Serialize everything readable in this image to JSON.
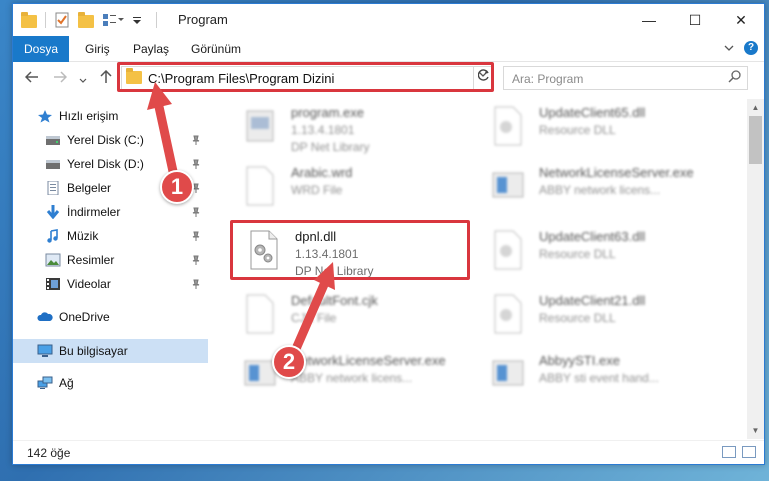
{
  "window": {
    "title": "Program",
    "controls": {
      "minimize": "—",
      "maximize": "☐",
      "close": "✕"
    }
  },
  "ribbon": {
    "tabs": [
      {
        "label": "Dosya"
      },
      {
        "label": "Giriş"
      },
      {
        "label": "Paylaş"
      },
      {
        "label": "Görünüm"
      }
    ],
    "expand_icon": "chevron-down-icon",
    "help_label": "?"
  },
  "address_bar": {
    "path": "C:\\Program Files\\Program Dizini",
    "search_placeholder": "Ara: Program"
  },
  "sidebar": {
    "items": [
      {
        "label": "Hızlı erişim",
        "icon": "star-icon",
        "pinned": false
      },
      {
        "label": "Yerel Disk (C:)",
        "icon": "drive-icon",
        "pinned": true
      },
      {
        "label": "Yerel Disk (D:)",
        "icon": "drive-icon",
        "pinned": true
      },
      {
        "label": "Belgeler",
        "icon": "documents-icon",
        "pinned": true
      },
      {
        "label": "İndirmeler",
        "icon": "download-icon",
        "pinned": true
      },
      {
        "label": "Müzik",
        "icon": "music-icon",
        "pinned": true
      },
      {
        "label": "Resimler",
        "icon": "pictures-icon",
        "pinned": true
      },
      {
        "label": "Videolar",
        "icon": "videos-icon",
        "pinned": true
      },
      {
        "label": "OneDrive",
        "icon": "cloud-icon",
        "pinned": false
      },
      {
        "label": "Bu bilgisayar",
        "icon": "computer-icon",
        "pinned": false,
        "selected": true
      },
      {
        "label": "Ağ",
        "icon": "network-icon",
        "pinned": false
      }
    ]
  },
  "files": [
    {
      "name": "program.exe",
      "line2": "1.13.4.1801",
      "line3": "DP Net Library",
      "blurred": true
    },
    {
      "name": "UpdateClient65.dll",
      "line2": "Resource DLL",
      "line3": "",
      "blurred": true
    },
    {
      "name": "Arabic.wrd",
      "line2": "WRD File",
      "line3": "",
      "blurred": true
    },
    {
      "name": "NetworkLicenseServer.exe",
      "line2": "ABBY network licens...",
      "line3": "",
      "blurred": true
    },
    {
      "name": "dpnl.dll",
      "line2": "1.13.4.1801",
      "line3": "DP Net Library",
      "blurred": false
    },
    {
      "name": "UpdateClient63.dll",
      "line2": "Resource DLL",
      "line3": "",
      "blurred": true
    },
    {
      "name": "DefaultFont.cjk",
      "line2": "CJK File",
      "line3": "",
      "blurred": true
    },
    {
      "name": "UpdateClient21.dll",
      "line2": "Resource DLL",
      "line3": "",
      "blurred": true
    },
    {
      "name": "NetworkLicenseServer.exe",
      "line2": "ABBY network licens...",
      "line3": "",
      "blurred": true
    },
    {
      "name": "AbbyySTI.exe",
      "line2": "ABBY sti event hand...",
      "line3": "",
      "blurred": true
    }
  ],
  "status": {
    "count": "142 öğe"
  },
  "annotations": {
    "step1": "1",
    "step2": "2",
    "color": "#e04a4a"
  }
}
